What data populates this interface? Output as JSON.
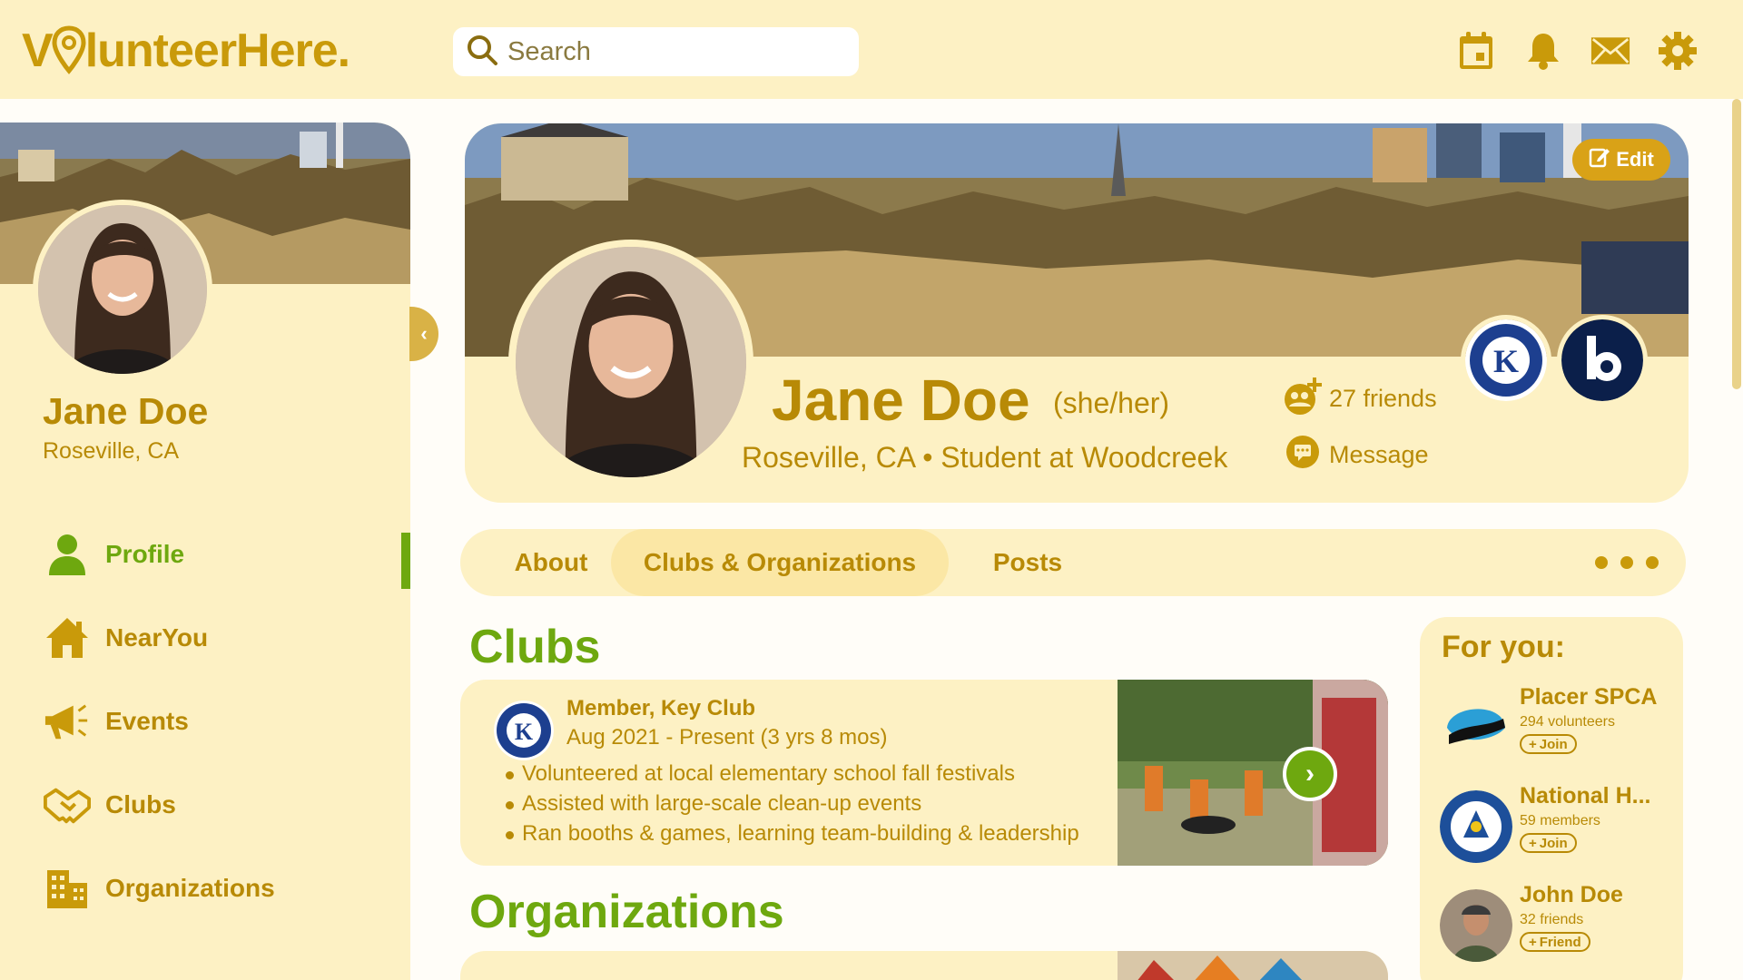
{
  "app": {
    "logo_pre": "V",
    "logo_post": "lunteerHere."
  },
  "search": {
    "placeholder": "Search"
  },
  "colors": {
    "accent": "#c99a0a",
    "green": "#6ea80f",
    "panel": "#fdf1c4",
    "brand_dark": "#b88a06"
  },
  "top_icons": [
    "calendar-icon",
    "bell-icon",
    "mail-icon",
    "gear-icon"
  ],
  "sidebar": {
    "name": "Jane Doe",
    "location": "Roseville, CA",
    "items": [
      {
        "label": "Profile",
        "icon": "person-icon",
        "active": true
      },
      {
        "label": "NearYou",
        "icon": "home-icon",
        "active": false
      },
      {
        "label": "Events",
        "icon": "megaphone-icon",
        "active": false
      },
      {
        "label": "Clubs",
        "icon": "handshake-icon",
        "active": false
      },
      {
        "label": "Organizations",
        "icon": "building-icon",
        "active": false
      }
    ]
  },
  "profile": {
    "edit_label": "Edit",
    "name": "Jane Doe",
    "pronouns": "(she/her)",
    "location": "Roseville, CA",
    "separator": "•",
    "school": "Student at Woodcreek",
    "friends": "27 friends",
    "message": "Message"
  },
  "tabs": [
    {
      "label": "About",
      "active": false
    },
    {
      "label": "Clubs & Organizations",
      "active": true
    },
    {
      "label": "Posts",
      "active": false
    }
  ],
  "clubs": {
    "title": "Clubs",
    "items": [
      {
        "role": "Member, Key Club",
        "dates": "Aug 2021 - Present (3 yrs 8 mos)",
        "bullets": [
          "Volunteered at local elementary school fall festivals",
          "Assisted with large-scale clean-up events",
          "Ran booths & games, learning team-building & leadership"
        ]
      }
    ]
  },
  "organizations": {
    "title": "Organizations"
  },
  "foryou": {
    "title": "For you:",
    "items": [
      {
        "title": "Placer SPCA",
        "meta": "294 volunteers",
        "action": "Join"
      },
      {
        "title": "National H...",
        "meta": "59 members",
        "action": "Join"
      },
      {
        "title": "John Doe",
        "meta": "32 friends",
        "action": "Friend"
      }
    ]
  }
}
